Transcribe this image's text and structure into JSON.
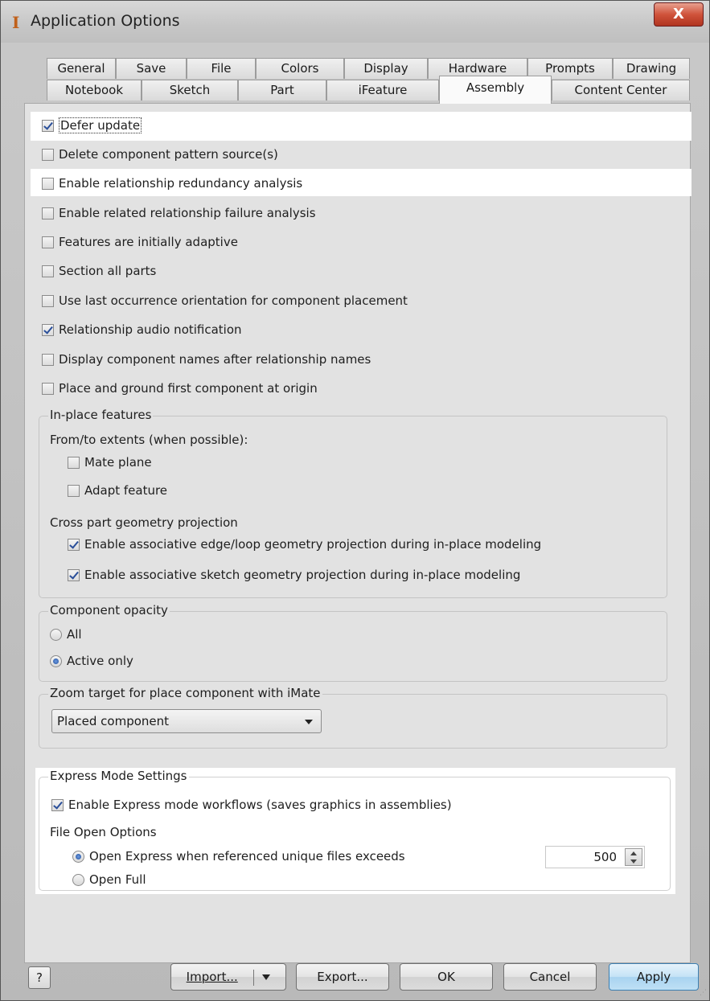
{
  "window": {
    "title": "Application Options",
    "close_label": "X"
  },
  "tabs_row1": [
    "General",
    "Save",
    "File",
    "Colors",
    "Display",
    "Hardware",
    "Prompts",
    "Drawing"
  ],
  "tabs_row2": [
    "Notebook",
    "Sketch",
    "Part",
    "iFeature",
    "Assembly",
    "Content Center"
  ],
  "active_tab": "Assembly",
  "options": {
    "defer_update": {
      "label": "Defer update",
      "checked": true
    },
    "delete_pattern_source": {
      "label": "Delete component pattern source(s)",
      "checked": false
    },
    "relationship_redundancy": {
      "label": "Enable relationship redundancy analysis",
      "checked": false
    },
    "related_failure": {
      "label": "Enable related relationship failure analysis",
      "checked": false
    },
    "initially_adaptive": {
      "label": "Features are initially adaptive",
      "checked": false
    },
    "section_all_parts": {
      "label": "Section all parts",
      "checked": false
    },
    "last_occurrence": {
      "label": "Use last occurrence orientation for component placement",
      "checked": false
    },
    "audio_notification": {
      "label": "Relationship audio notification",
      "checked": true
    },
    "display_names": {
      "label": "Display component names after relationship names",
      "checked": false
    },
    "place_ground": {
      "label": "Place and ground first component at origin",
      "checked": false
    }
  },
  "inplace": {
    "legend": "In-place features",
    "extents_label": "From/to extents (when possible):",
    "mate_plane": {
      "label": "Mate plane",
      "checked": false
    },
    "adapt_feature": {
      "label": "Adapt feature",
      "checked": false
    },
    "cross_part_label": "Cross part geometry projection",
    "edge_loop": {
      "label": "Enable associative edge/loop geometry projection during in-place modeling",
      "checked": true
    },
    "sketch_geom": {
      "label": "Enable associative sketch geometry projection during in-place modeling",
      "checked": true
    }
  },
  "opacity": {
    "legend": "Component opacity",
    "all": {
      "label": "All",
      "checked": false
    },
    "active_only": {
      "label": "Active only",
      "checked": true
    }
  },
  "zoom": {
    "legend": "Zoom target for place component with iMate",
    "selected": "Placed component"
  },
  "express": {
    "legend": "Express Mode Settings",
    "enable": {
      "label": "Enable Express mode workflows (saves graphics in assemblies)",
      "checked": true
    },
    "file_open_label": "File Open Options",
    "open_express": {
      "label": "Open Express when referenced unique files exceeds",
      "checked": true
    },
    "open_full": {
      "label": "Open Full",
      "checked": false
    },
    "threshold": "500"
  },
  "buttons": {
    "help": "?",
    "import": "Import...",
    "export": "Export...",
    "ok": "OK",
    "cancel": "Cancel",
    "apply": "Apply"
  },
  "icons": [
    "app-icon",
    "close-icon",
    "help-icon",
    "dropdown-arrow-icon",
    "spin-up-icon",
    "spin-down-icon"
  ]
}
